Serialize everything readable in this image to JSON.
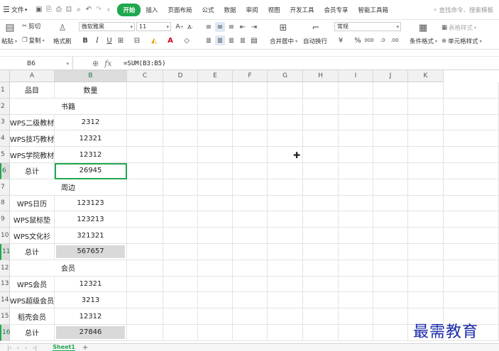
{
  "menubar": {
    "file_label": "文件",
    "tabs": [
      "开始",
      "插入",
      "页面布局",
      "公式",
      "数据",
      "审阅",
      "视图",
      "开发工具",
      "会员专享",
      "智能工具箱"
    ],
    "search_placeholder": "查找命令、搜索模板"
  },
  "ribbon": {
    "cut": "剪切",
    "paste": "粘贴",
    "copy": "复制",
    "format_painter": "格式刷",
    "font_name": "微软雅黑",
    "font_size": "11",
    "number_format": "常规",
    "merge_center": "合并居中",
    "wrap_text": "自动换行",
    "conditional_format": "条件格式",
    "cell_style": "单元格样式",
    "table_style": "表格样式"
  },
  "formula_bar": {
    "cell_ref": "B6",
    "formula": "=SUM(B3:B5)"
  },
  "grid": {
    "columns": [
      "A",
      "B",
      "C",
      "D",
      "E",
      "F",
      "G",
      "H",
      "I",
      "J",
      "K"
    ],
    "rows": [
      {
        "num": "1",
        "a": "品目",
        "b": "数量",
        "merged": false
      },
      {
        "num": "2",
        "a": "书籍",
        "b": "",
        "merged": true
      },
      {
        "num": "3",
        "a": "WPS二级教材",
        "b": "2312",
        "merged": false
      },
      {
        "num": "4",
        "a": "WPS技巧教材",
        "b": "12321",
        "merged": false
      },
      {
        "num": "5",
        "a": "WPS学院教材",
        "b": "12312",
        "merged": false
      },
      {
        "num": "6",
        "a": "总计",
        "b": "26945",
        "merged": false
      },
      {
        "num": "7",
        "a": "周边",
        "b": "",
        "merged": true
      },
      {
        "num": "8",
        "a": "WPS日历",
        "b": "123123",
        "merged": false
      },
      {
        "num": "9",
        "a": "WPS鼠标垫",
        "b": "123213",
        "merged": false
      },
      {
        "num": "10",
        "a": "WPS文化衫",
        "b": "321321",
        "merged": false
      },
      {
        "num": "11",
        "a": "总计",
        "b": "567657",
        "merged": false
      },
      {
        "num": "12",
        "a": "会员",
        "b": "",
        "merged": true
      },
      {
        "num": "13",
        "a": "WPS会员",
        "b": "12321",
        "merged": false
      },
      {
        "num": "14",
        "a": "WPS超级会员",
        "b": "3213",
        "merged": false
      },
      {
        "num": "15",
        "a": "稻壳会员",
        "b": "12312",
        "merged": false
      },
      {
        "num": "16",
        "a": "总计",
        "b": "27846",
        "merged": false
      }
    ],
    "active_row": "6",
    "shaded_rows": [
      "11",
      "16"
    ]
  },
  "sheets": {
    "active": "Sheet1"
  },
  "watermark": "最需教育"
}
